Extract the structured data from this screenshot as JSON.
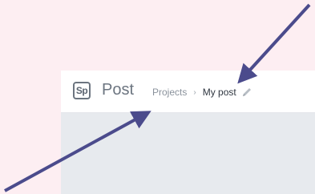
{
  "header": {
    "logo_text": "Sp",
    "app_name": "Post"
  },
  "breadcrumb": {
    "parent": "Projects",
    "separator": "›",
    "current": "My post"
  },
  "icons": {
    "edit": "pencil-icon"
  },
  "colors": {
    "page_background": "#fdeef2",
    "arrow": "#4b4b8c",
    "canvas": "#e7eaee"
  }
}
